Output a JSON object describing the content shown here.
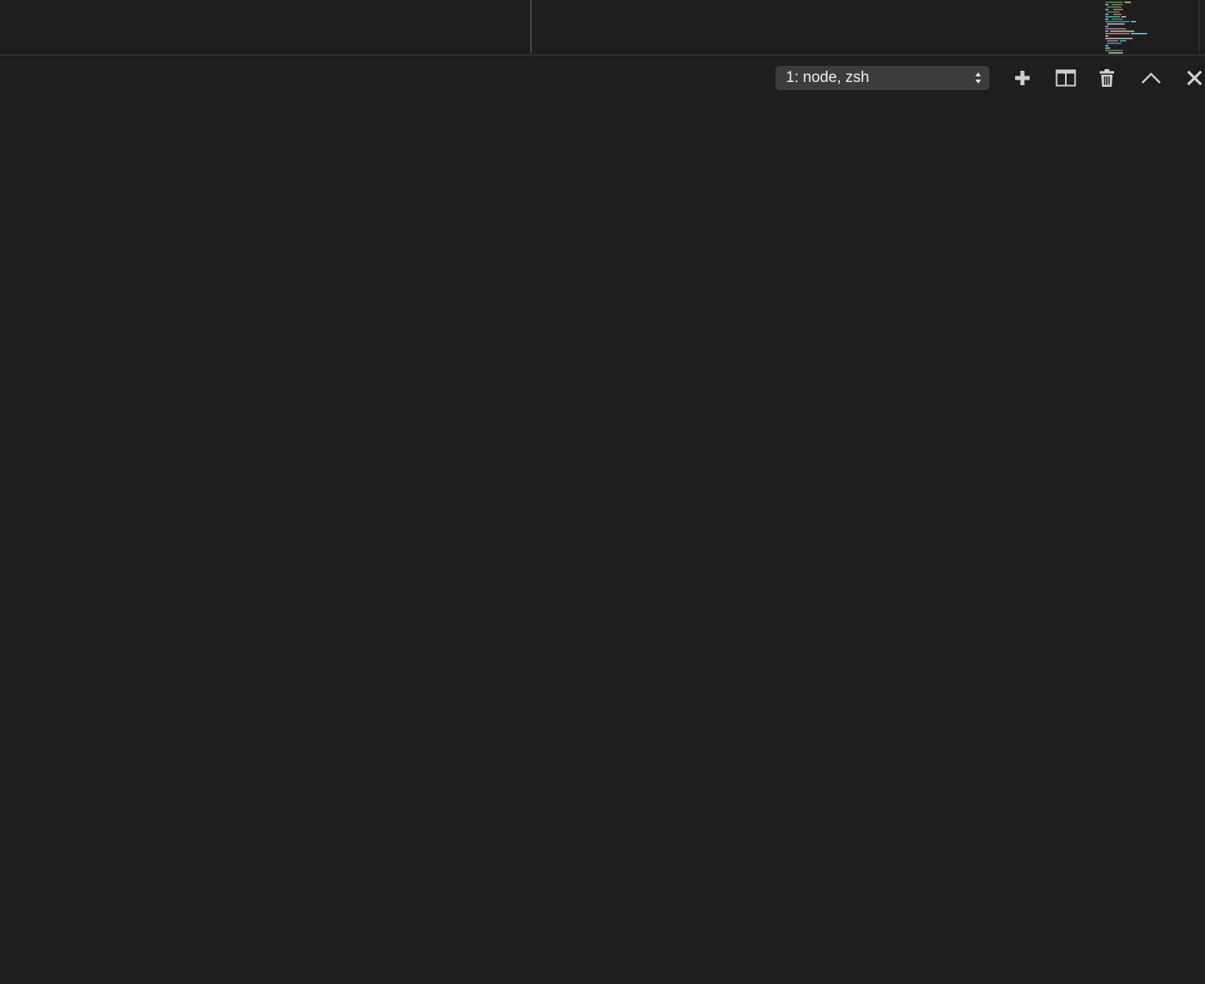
{
  "editor": {
    "minimap_colors": [
      "#6a9955",
      "#9cdcfe",
      "#ce9178",
      "#569cd6",
      "#dcdcaa",
      "#c586c0",
      "#4ec9b0",
      "#d4d4d4"
    ]
  },
  "panel": {
    "terminal_select": {
      "selected_label": "1: node, zsh"
    },
    "toolbar": {
      "new_terminal_icon": "plus-icon",
      "split_terminal_icon": "split-icon",
      "kill_terminal_icon": "trash-icon",
      "maximize_panel_icon": "chevron-up-icon",
      "close_panel_icon": "close-icon"
    }
  },
  "colors": {
    "background": "#1e1e1e",
    "select_bg": "#3c3c3c",
    "icon": "#cccccc",
    "text": "#f0f0f0"
  }
}
